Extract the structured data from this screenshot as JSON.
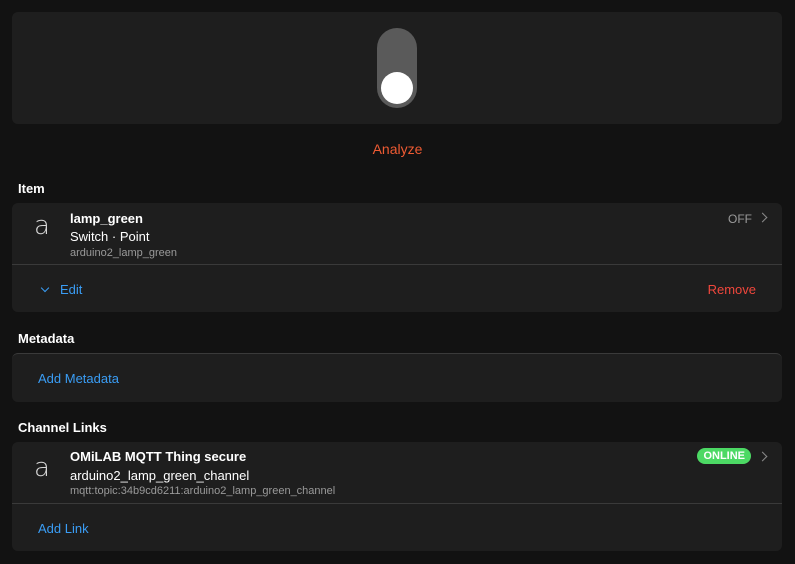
{
  "toggle": {
    "state": "off"
  },
  "actions": {
    "analyze_label": "Analyze"
  },
  "item_section": {
    "title": "Item",
    "avatar_letter": "a",
    "name": "lamp_green",
    "type": "Switch · Point",
    "id": "arduino2_lamp_green",
    "state": "OFF",
    "edit_label": "Edit",
    "remove_label": "Remove"
  },
  "metadata_section": {
    "title": "Metadata",
    "add_label": "Add Metadata"
  },
  "channel_section": {
    "title": "Channel Links",
    "avatar_letter": "a",
    "thing": "OMiLAB MQTT Thing secure",
    "channel": "arduino2_lamp_green_channel",
    "uid": "mqtt:topic:34b9cd6211:arduino2_lamp_green_channel",
    "status": "ONLINE",
    "add_label": "Add Link"
  },
  "colors": {
    "accent": "#3a9df5",
    "analyze": "#ef5b33",
    "remove": "#f0473c",
    "online": "#4cd964"
  }
}
